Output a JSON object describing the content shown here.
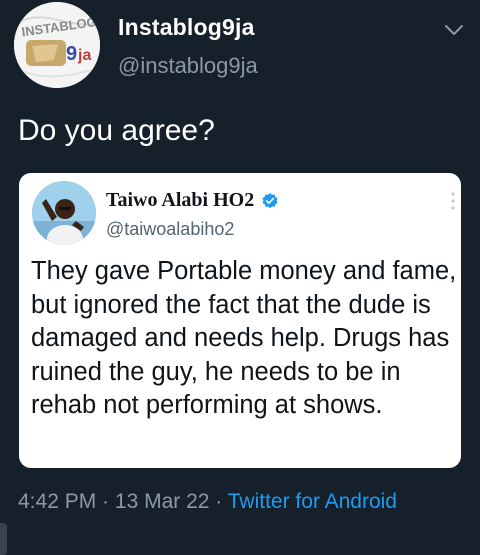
{
  "author": {
    "name": "Instablog9ja",
    "handle": "@instablog9ja",
    "avatar_logo_text": "INSTABLOG 9ja"
  },
  "tweet": {
    "text": "Do you agree?"
  },
  "quoted_tweet": {
    "name": "Taiwo Alabi HO2",
    "handle": "@taiwoalabiho2",
    "text": "They gave Portable money and fame, but ignored the fact that the dude is damaged and needs help. Drugs has ruined the guy, he needs to be in rehab not performing at shows.",
    "verified_color": "#1d9bf0"
  },
  "meta": {
    "time": "4:42 PM",
    "separator1": " · ",
    "date": "13 Mar 22",
    "separator2": " · ",
    "source": "Twitter for Android"
  },
  "colors": {
    "background": "#15202b",
    "text_primary": "#ffffff",
    "text_secondary": "#8b98a5",
    "accent": "#1d9bf0",
    "card": "#ffffff"
  },
  "icons": {
    "more": "chevron-down-icon",
    "verified": "verified-badge-icon",
    "quote_more": "vertical-dots-icon"
  }
}
